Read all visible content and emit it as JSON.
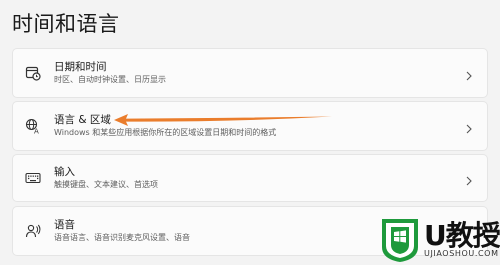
{
  "page": {
    "title": "时间和语言"
  },
  "items": [
    {
      "title": "日期和时间",
      "subtitle": "时区、自动时钟设置、日历显示",
      "icon": "calendar-clock-icon"
    },
    {
      "title": "语言 & 区域",
      "subtitle": "Windows 和某些应用根据你所在的区域设置日期和时间的格式",
      "icon": "globe-language-icon"
    },
    {
      "title": "输入",
      "subtitle": "触摸键盘、文本建议、首选项",
      "icon": "keyboard-icon"
    },
    {
      "title": "语音",
      "subtitle": "语音语言、语音识别麦克风设置、语音",
      "icon": "microphone-person-icon"
    }
  ],
  "annotation": {
    "color": "#ea7d2c",
    "points_to": "语言 & 区域"
  },
  "watermark": {
    "word": "U教授",
    "site": "UJIAOSHOU.COM",
    "accent": "#1e9a3c"
  }
}
